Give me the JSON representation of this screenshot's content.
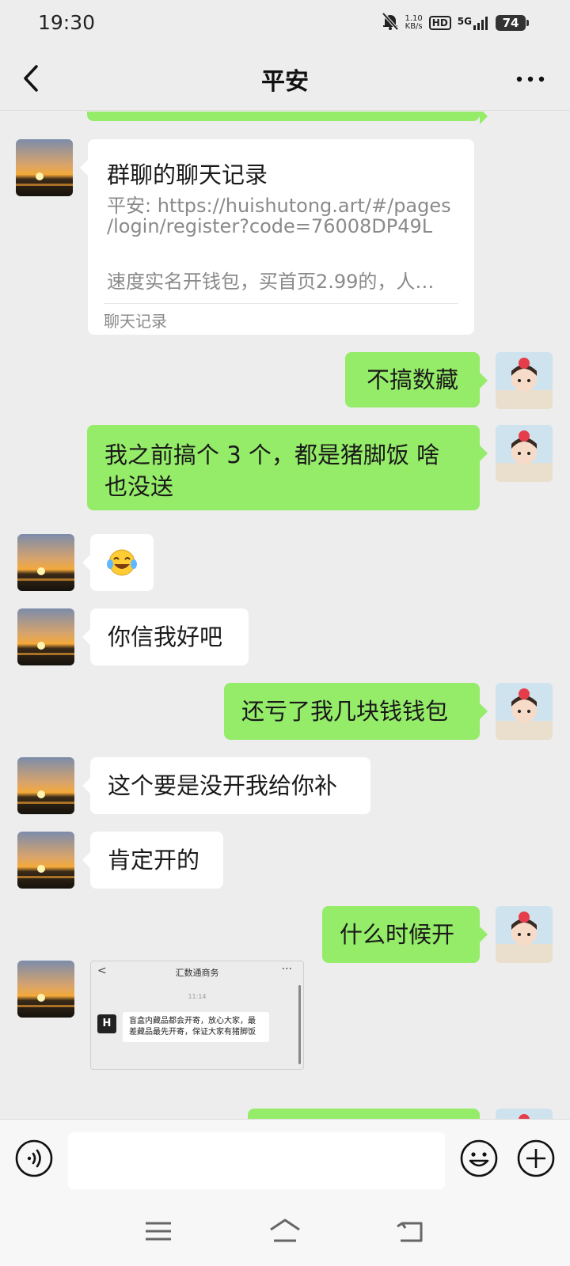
{
  "status_bar": {
    "time": "19:30",
    "net_speed_value": "1.10",
    "net_speed_unit": "KB/s",
    "hd_label": "HD",
    "network_label": "5G",
    "battery": "74",
    "icons": [
      "mute-bell-icon",
      "signal-icon",
      "battery-icon"
    ]
  },
  "header": {
    "title": "平安",
    "back_icon": "chevron-left-icon",
    "more_icon": "more-dots-icon"
  },
  "messages": [
    {
      "sender": "them",
      "type": "chat_record_card",
      "title": "群聊的聊天记录",
      "line1": "平安: https://huishutong.art/#/pages",
      "line2": "/login/register?code=76008DP49L",
      "line3": "速度实名开钱包，买首页2.99的，人…",
      "footer": "聊天记录"
    },
    {
      "sender": "me",
      "type": "text",
      "text": "不搞数藏"
    },
    {
      "sender": "me",
      "type": "text",
      "text_line1": "我之前搞个 3 个，都是猪脚饭 啥",
      "text_line2": "也没送"
    },
    {
      "sender": "them",
      "type": "emoji",
      "text": "😂"
    },
    {
      "sender": "them",
      "type": "text",
      "text": "你信我好吧"
    },
    {
      "sender": "me",
      "type": "text",
      "text": "还亏了我几块钱钱包"
    },
    {
      "sender": "them",
      "type": "text",
      "text": "这个要是没开我给你补"
    },
    {
      "sender": "them",
      "type": "text",
      "text": "肯定开的"
    },
    {
      "sender": "me",
      "type": "text",
      "text": "什么时候开"
    },
    {
      "sender": "them",
      "type": "image",
      "screenshot": {
        "back": "<",
        "title": "汇数通商务",
        "more": "···",
        "time": "11:14",
        "logo": "H",
        "text": "盲盒内藏品都会开寄，放心大家，最差藏品最先开寄，保证大家有猪脚饭"
      }
    }
  ],
  "input_bar": {
    "placeholder": "",
    "voice_icon": "voice-icon",
    "emoji_icon": "emoji-icon",
    "plus_icon": "plus-icon"
  },
  "system_nav": {
    "icons": [
      "menu-icon",
      "home-icon",
      "back-icon"
    ]
  },
  "colors": {
    "background": "#ededed",
    "my_bubble": "#95ec69",
    "their_bubble": "#ffffff"
  }
}
